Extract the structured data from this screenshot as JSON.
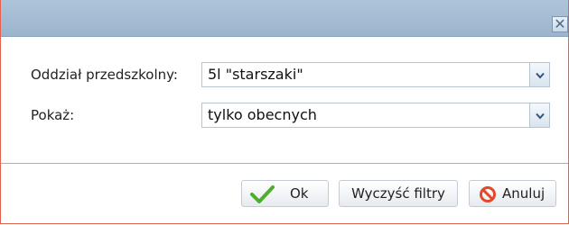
{
  "titlebar": {
    "close_icon": "close-icon",
    "close_glyph": "✕"
  },
  "form": {
    "group_label": "Oddział przedszkolny:",
    "group_value": "5l \"starszaki\"",
    "show_label": "Pokaż:",
    "show_value": "tylko obecnych",
    "dropdown_icon": "chevron-down-icon"
  },
  "buttons": {
    "ok_label": "Ok",
    "ok_icon": "checkmark-icon",
    "clear_label": "Wyczyść filtry",
    "cancel_label": "Anuluj",
    "cancel_icon": "no-entry-icon"
  },
  "colors": {
    "dialog_border": "#e2614f",
    "titlebar": "#9bb4cd",
    "ok_check": "#4caf2a",
    "cancel_icon": "#e04a2a"
  }
}
